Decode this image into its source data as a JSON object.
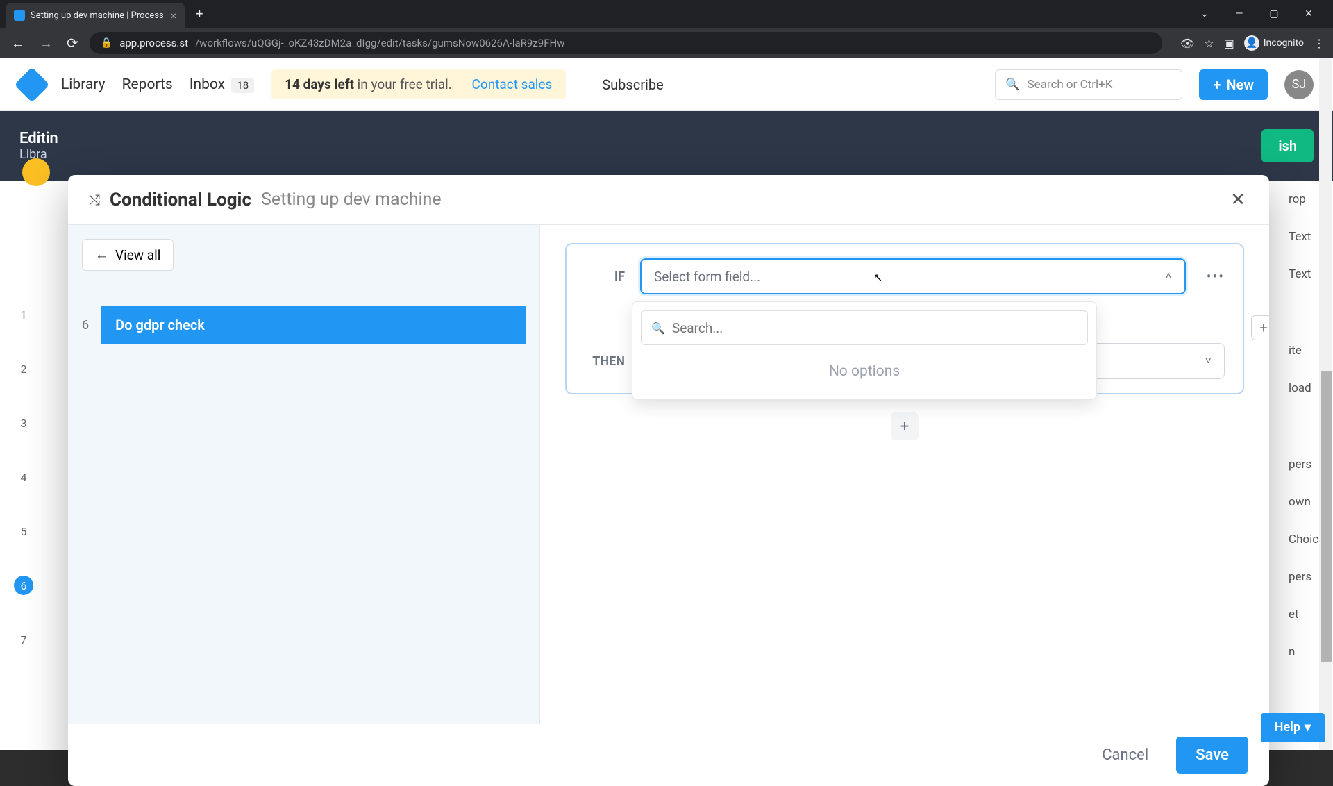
{
  "browser": {
    "tab_title": "Setting up dev machine | Process",
    "url_domain": "app.process.st",
    "url_path": "/workflows/uQGGj-_oKZ43zDM2a_dIgg/edit/tasks/gumsNow0626A-laR9z9FHw",
    "incognito_label": "Incognito"
  },
  "app_nav": {
    "library": "Library",
    "reports": "Reports",
    "inbox": "Inbox",
    "inbox_count": "18",
    "trial_days": "14 days left",
    "trial_rest": " in your free trial.",
    "contact_sales": "Contact sales",
    "subscribe": "Subscribe",
    "search_placeholder": "Search or Ctrl+K",
    "new": "New",
    "avatar": "SJ"
  },
  "editing": {
    "label": "Editin",
    "breadcrumb": "Libra",
    "publish": "ish"
  },
  "side_fields": [
    "rop",
    "Text",
    "Text",
    "ite",
    "load",
    "pers",
    "own",
    "Choice",
    "pers",
    "et",
    "n"
  ],
  "bg_list": [
    "1",
    "2",
    "3",
    "4",
    "5",
    "6",
    "7"
  ],
  "modal": {
    "title": "Conditional Logic",
    "subtitle": "Setting up dev machine",
    "view_all": "View all",
    "task_num": "6",
    "task_name": "Do gdpr check",
    "if_label": "IF",
    "then_label": "THEN",
    "select_placeholder": "Select form field...",
    "search_placeholder": "Search...",
    "no_options": "No options",
    "cancel": "Cancel",
    "save": "Save"
  },
  "help": "Help"
}
